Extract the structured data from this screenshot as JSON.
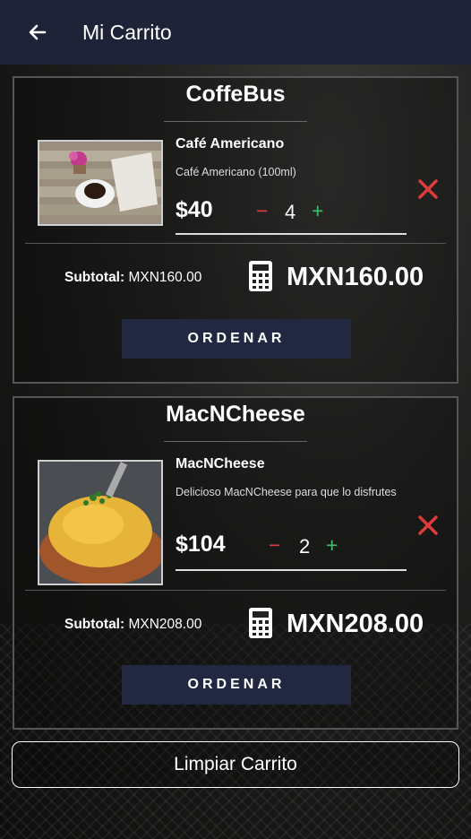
{
  "header": {
    "title": "Mi Carrito"
  },
  "carts": [
    {
      "store": "CoffeBus",
      "item": {
        "name": "Café Americano",
        "description": "Café Americano (100ml)",
        "price": "$40",
        "quantity": "4",
        "minus": "−",
        "plus": "+"
      },
      "subtotal_label": "Subtotal:",
      "subtotal_value": "MXN160.00",
      "total": "MXN160.00",
      "order_label": "ORDENAR"
    },
    {
      "store": "MacNCheese",
      "item": {
        "name": "MacNCheese",
        "description": "Delicioso MacNCheese para que lo disfrutes",
        "price": "$104",
        "quantity": "2",
        "minus": "−",
        "plus": "+"
      },
      "subtotal_label": "Subtotal:",
      "subtotal_value": "MXN208.00",
      "total": "MXN208.00",
      "order_label": "ORDENAR"
    }
  ],
  "clear_label": "Limpiar Carrito",
  "colors": {
    "appbar": "#1f2338",
    "button": "#232842",
    "delete": "#e03b3b",
    "plus": "#3bc26b"
  }
}
